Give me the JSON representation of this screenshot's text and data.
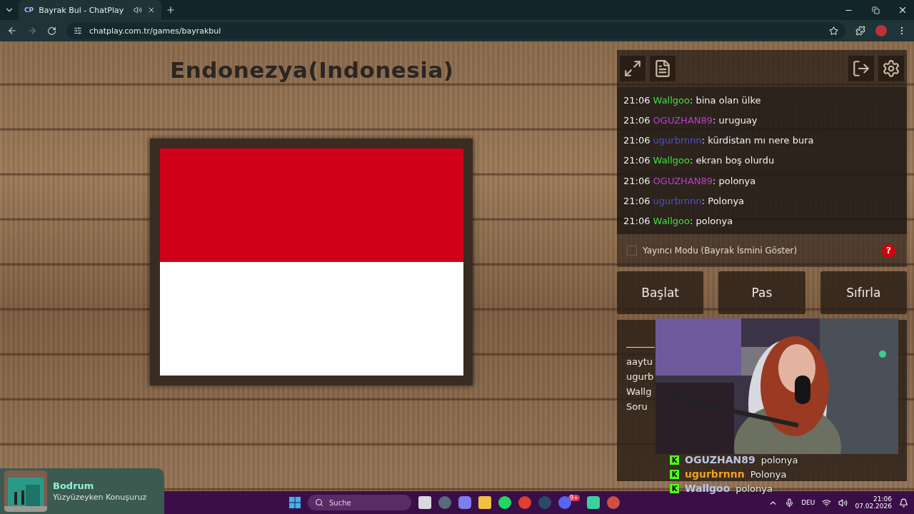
{
  "browser": {
    "tab_favicon": "CP",
    "tab_title": "Bayrak Bul - ChatPlay",
    "url": "chatplay.com.tr/games/bayrakbul"
  },
  "game": {
    "country": "Endonezya(Indonesia)",
    "flag": {
      "stripes": [
        {
          "color": "#d0001a"
        },
        {
          "color": "#ffffff"
        }
      ]
    }
  },
  "chat": {
    "messages": [
      {
        "time": "21:06",
        "user": "Wallgoo",
        "color": "#3fe03f",
        "text": ": bina olan ülke"
      },
      {
        "time": "21:06",
        "user": "OGUZHAN89",
        "color": "#c23ccf",
        "text": ": uruguay"
      },
      {
        "time": "21:06",
        "user": "ugurbrnnn",
        "color": "#4b4fd8",
        "text": ": kürdistan mı nere bura"
      },
      {
        "time": "21:06",
        "user": "Wallgoo",
        "color": "#3fe03f",
        "text": ": ekran boş olurdu"
      },
      {
        "time": "21:06",
        "user": "OGUZHAN89",
        "color": "#c23ccf",
        "text": ": polonya"
      },
      {
        "time": "21:06",
        "user": "ugurbrnnn",
        "color": "#4b4fd8",
        "text": ": Polonya"
      },
      {
        "time": "21:06",
        "user": "Wallgoo",
        "color": "#3fe03f",
        "text": ": polonya"
      }
    ]
  },
  "streamer_mode": {
    "label": "Yayıncı Modu (Bayrak İsmini Göster)",
    "checked": false,
    "help": "?"
  },
  "buttons": [
    "Başlat",
    "Pas",
    "Sıfırla"
  ],
  "scoreboard": {
    "rows": [
      "aaytu",
      "ugurb",
      "Wallg",
      "Soru"
    ]
  },
  "webcam": {
    "kind": "picture"
  },
  "stream_chat": [
    {
      "badge": "K",
      "user": "OGUZHAN89",
      "color": "#b9c6e6",
      "text": "polonya"
    },
    {
      "badge": "K",
      "user": "ugurbrnnn",
      "color": "#f0a020",
      "text": "Polonya"
    },
    {
      "badge": "K",
      "user": "Wallgoo",
      "color": "#b9c6f2",
      "text": "polonya"
    }
  ],
  "now_playing": {
    "title": "Bodrum",
    "artist": "Yüzyüzeyken Konuşuruz"
  },
  "taskbar": {
    "search": "Suche",
    "discord_badge": "9+",
    "language": "DEU",
    "time": "21:06",
    "date": "07.02.2026"
  }
}
